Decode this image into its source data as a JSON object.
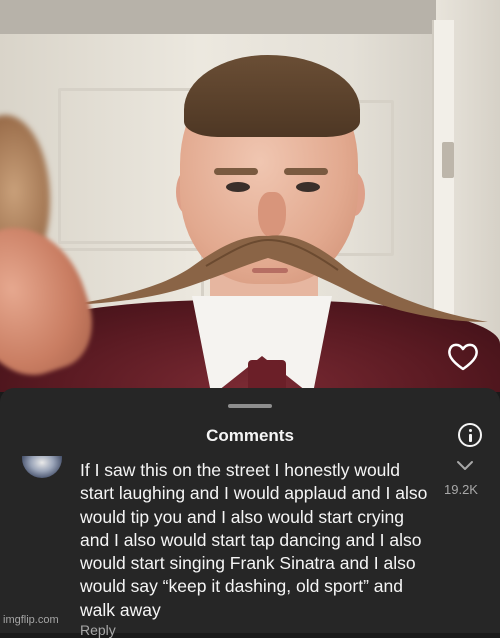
{
  "photo": {
    "like_icon": "heart-outline-icon"
  },
  "comments_sheet": {
    "title": "Comments",
    "info_icon": "info-icon",
    "comment": {
      "text": "If I saw this on the street I honestly would start laughing and I would applaud and I also would tip you and I also would start crying and I also would start tap dancing and I also would start singing Frank Sinatra and I also would say “keep it dashing, old sport” and walk away",
      "like_count": "19.2K",
      "reply_label": "Reply",
      "like_icon": "chevron-down-icon"
    }
  },
  "watermark": "imgflip.com",
  "colors": {
    "sheet_background": "#262626",
    "text_primary": "#f5f5f5",
    "text_secondary": "#a8a8a8"
  }
}
